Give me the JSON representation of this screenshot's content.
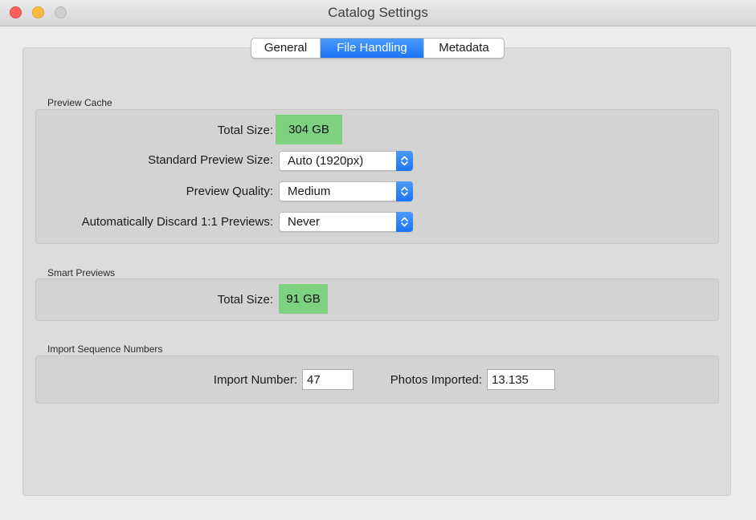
{
  "window": {
    "title": "Catalog Settings"
  },
  "tabs": [
    {
      "label": "General",
      "selected": false
    },
    {
      "label": "File Handling",
      "selected": true
    },
    {
      "label": "Metadata",
      "selected": false
    }
  ],
  "preview_cache": {
    "heading": "Preview Cache",
    "total_size_label": "Total Size:",
    "total_size_value": "304 GB",
    "standard_preview_label": "Standard Preview Size:",
    "standard_preview_value": "Auto (1920px)",
    "quality_label": "Preview Quality:",
    "quality_value": "Medium",
    "discard_label": "Automatically Discard 1:1 Previews:",
    "discard_value": "Never"
  },
  "smart_previews": {
    "heading": "Smart Previews",
    "total_size_label": "Total Size:",
    "total_size_value": "91 GB"
  },
  "import_sequence": {
    "heading": "Import Sequence Numbers",
    "import_number_label": "Import Number:",
    "import_number_value": "47",
    "photos_imported_label": "Photos Imported:",
    "photos_imported_value": "13.135"
  },
  "colors": {
    "accent": "#1b74f5",
    "highlight_green": "#7ed17f",
    "close": "#fc605c",
    "minimize": "#fdbc40",
    "zoom_disabled": "#cfcfcf"
  },
  "icons": {
    "window_close": "close-button",
    "window_minimize": "minimize-button",
    "window_zoom": "zoom-button",
    "popup_arrows": "updown-chevron-icon"
  }
}
